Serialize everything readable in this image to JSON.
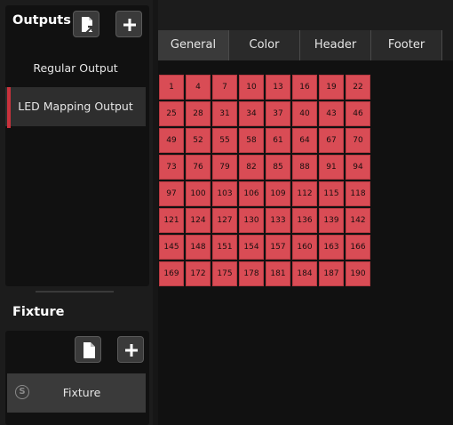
{
  "outputs": {
    "title": "Outputs",
    "items": [
      {
        "label": "Regular Output"
      },
      {
        "label": "LED Mapping Output",
        "active": true
      }
    ]
  },
  "fixture": {
    "title": "Fixture",
    "items": [
      {
        "label": "Fixture",
        "badge": "S"
      }
    ]
  },
  "tabs": [
    {
      "label": "General",
      "active": true
    },
    {
      "label": "Color"
    },
    {
      "label": "Header"
    },
    {
      "label": "Footer"
    }
  ],
  "grid": {
    "rows": [
      [
        "1",
        "4",
        "7",
        "10",
        "13",
        "16",
        "19",
        "22"
      ],
      [
        "25",
        "28",
        "31",
        "34",
        "37",
        "40",
        "43",
        "46"
      ],
      [
        "49",
        "52",
        "55",
        "58",
        "61",
        "64",
        "67",
        "70"
      ],
      [
        "73",
        "76",
        "79",
        "82",
        "85",
        "88",
        "91",
        "94"
      ],
      [
        "97",
        "100",
        "103",
        "106",
        "109",
        "112",
        "115",
        "118"
      ],
      [
        "121",
        "124",
        "127",
        "130",
        "133",
        "136",
        "139",
        "142"
      ],
      [
        "145",
        "148",
        "151",
        "154",
        "157",
        "160",
        "163",
        "166"
      ],
      [
        "169",
        "172",
        "175",
        "178",
        "181",
        "184",
        "187",
        "190"
      ]
    ]
  },
  "colors": {
    "accent": "#c8323c",
    "cell": "#d94c55"
  },
  "icons": {
    "export": "export-file-icon",
    "add": "plus-icon",
    "document": "document-icon",
    "status": "s-circle-icon"
  }
}
